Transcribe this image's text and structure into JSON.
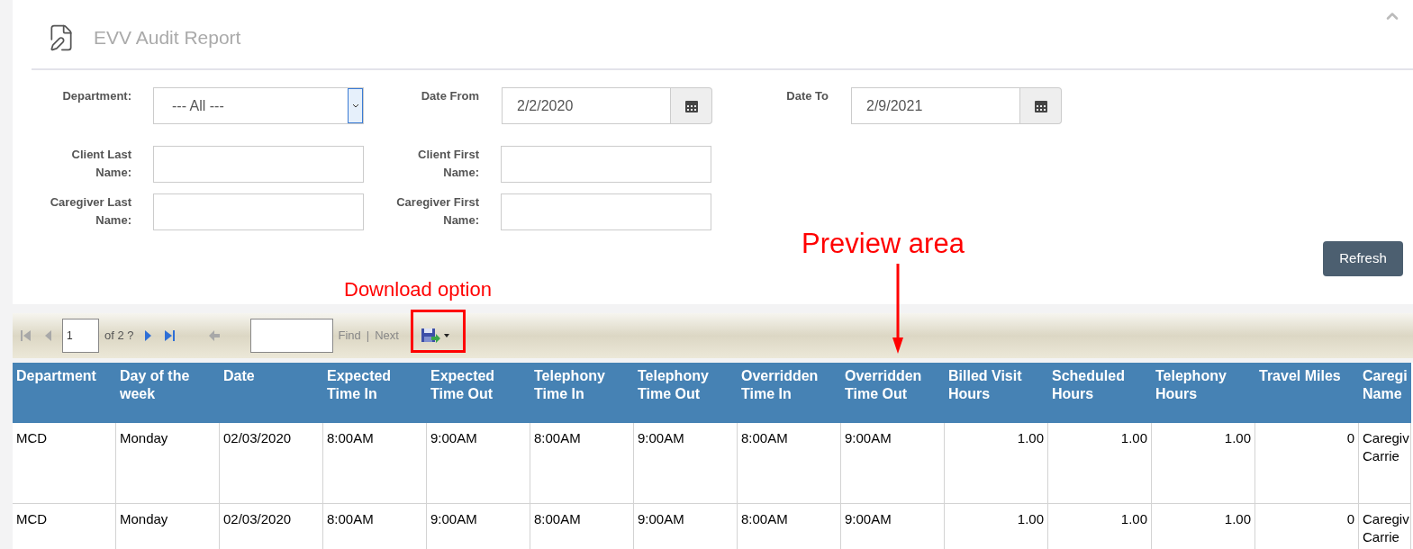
{
  "header": {
    "title": "EVV Audit Report"
  },
  "filters": [
    [
      {
        "label": "Department:",
        "kind": "select",
        "value": "--- All ---"
      },
      {
        "label": "Date From",
        "kind": "date",
        "value": "2/2/2020"
      },
      {
        "label": "Date To",
        "kind": "date",
        "value": "2/9/2021"
      }
    ],
    [
      {
        "label": "Client Last Name:",
        "kind": "text"
      },
      {
        "label": "Client First Name:",
        "kind": "text"
      }
    ],
    [
      {
        "label": "Caregiver Last Name:",
        "kind": "text"
      },
      {
        "label": "Caregiver First Name:",
        "kind": "text"
      }
    ]
  ],
  "refresh_button": "Refresh",
  "toolbar": {
    "nav_first": {
      "disabled": true
    },
    "nav_prev": {
      "disabled": true
    },
    "page": "1",
    "page_of": "of 2 ?",
    "nav_next": {
      "disabled": false
    },
    "nav_last": {
      "disabled": false
    },
    "back": {
      "disabled": true
    },
    "find": "Find",
    "separator": "|",
    "next": "Next"
  },
  "table": {
    "columns": [
      {
        "label": "Department",
        "kind": "text"
      },
      {
        "label": "Day of the week",
        "kind": "text"
      },
      {
        "label": "Date",
        "kind": "text"
      },
      {
        "label": "Expected Time In",
        "kind": "text"
      },
      {
        "label": "Expected Time Out",
        "kind": "text"
      },
      {
        "label": "Telephony Time In",
        "kind": "text"
      },
      {
        "label": "Telephony Time Out",
        "kind": "text"
      },
      {
        "label": "Overridden Time In",
        "kind": "text"
      },
      {
        "label": "Overridden Time Out",
        "kind": "text"
      },
      {
        "label": "Billed Visit Hours",
        "kind": "number"
      },
      {
        "label": "Scheduled Hours",
        "kind": "number"
      },
      {
        "label": "Telephony Hours",
        "kind": "number"
      },
      {
        "label": "Travel Miles",
        "kind": "number"
      },
      {
        "label": "Caregi Name",
        "kind": "text"
      }
    ],
    "rows": [
      [
        "MCD",
        "Monday",
        "02/03/2020",
        "8:00AM",
        "9:00AM",
        "8:00AM",
        "9:00AM",
        "8:00AM",
        "9:00AM",
        "1.00",
        "1.00",
        "1.00",
        "0",
        "Caregiv Carrie"
      ],
      [
        "MCD",
        "Monday",
        "02/03/2020",
        "8:00AM",
        "9:00AM",
        "8:00AM",
        "9:00AM",
        "8:00AM",
        "9:00AM",
        "1.00",
        "1.00",
        "1.00",
        "0",
        "Caregiv Carrie"
      ]
    ]
  },
  "annotations": [
    {
      "kind": "box",
      "text": "Download option"
    },
    {
      "kind": "arrow",
      "text": "Preview area"
    }
  ]
}
